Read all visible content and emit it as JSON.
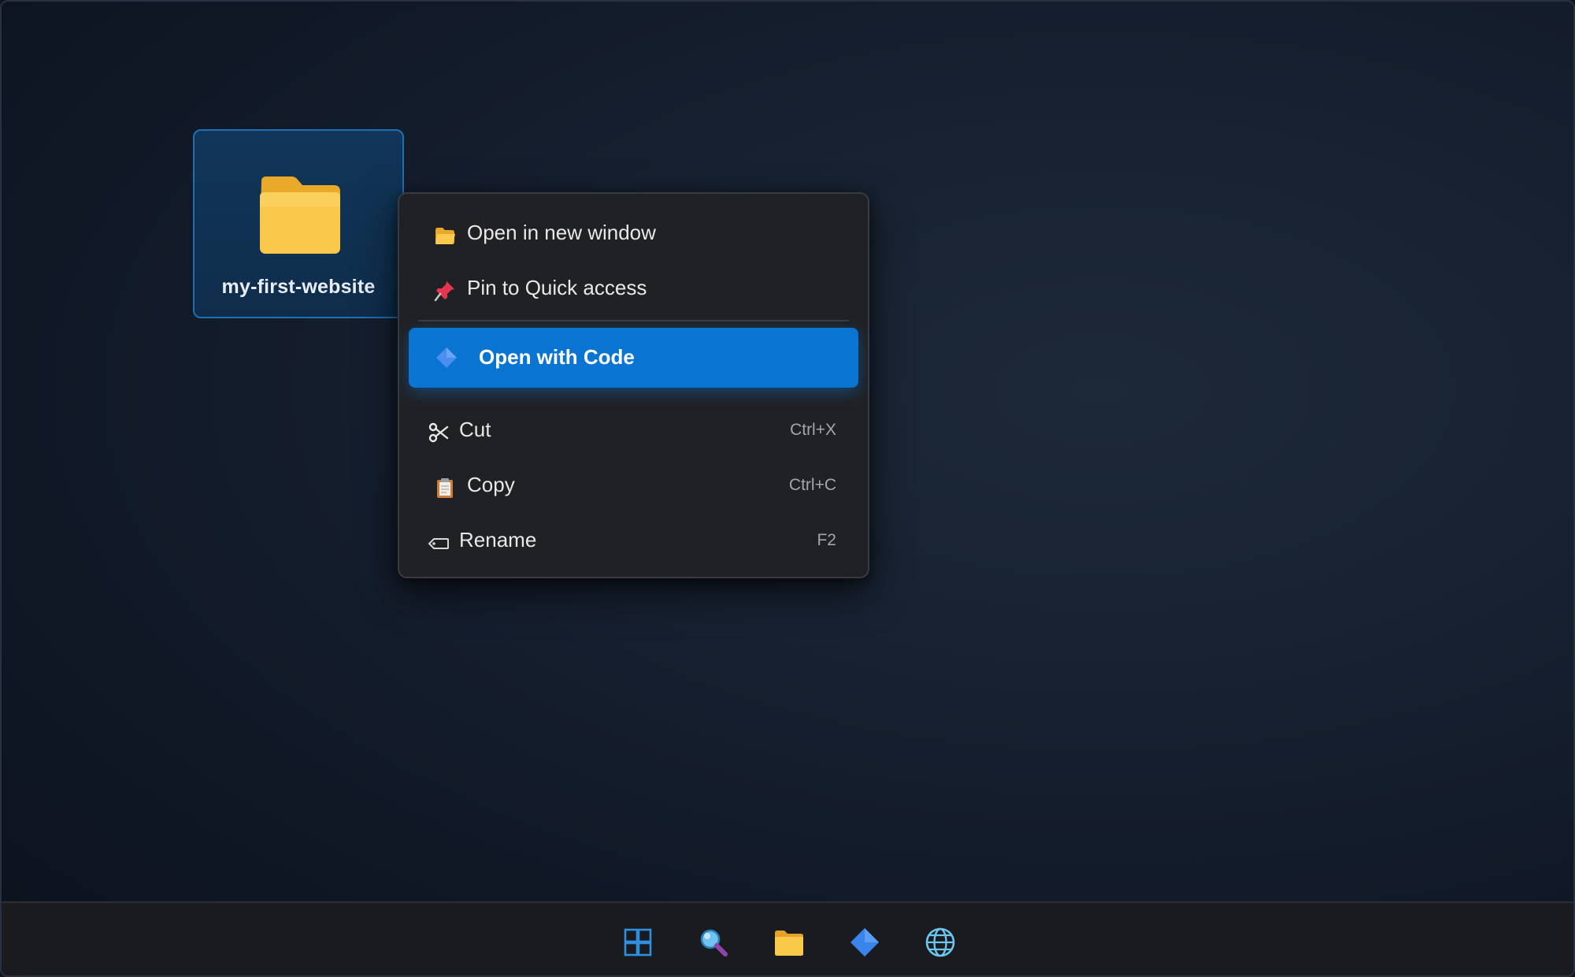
{
  "desktop": {
    "folder": {
      "name": "my-first-website",
      "icon": "folder-icon"
    }
  },
  "context_menu": {
    "items": [
      {
        "label": "Open in new window",
        "icon": "folder-open-icon",
        "shortcut": ""
      },
      {
        "label": "Pin to Quick access",
        "icon": "pushpin-icon",
        "shortcut": ""
      },
      {
        "label": "Open with Code",
        "icon": "code-diamond-icon",
        "shortcut": "",
        "highlighted": true
      },
      {
        "label": "Cut",
        "icon": "scissors-icon",
        "shortcut": "Ctrl+X"
      },
      {
        "label": "Copy",
        "icon": "clipboard-icon",
        "shortcut": "Ctrl+C"
      },
      {
        "label": "Rename",
        "icon": "rename-tag-icon",
        "shortcut": "F2"
      }
    ]
  },
  "taskbar": {
    "icons": [
      "windows-start-icon",
      "search-icon",
      "file-explorer-icon",
      "code-editor-icon",
      "browser-globe-icon"
    ]
  },
  "colors": {
    "accent": "#0a74d3",
    "menu_background": "#202124",
    "folder_yellow": "#f7c244",
    "taskbar_background": "#1a1b1e"
  }
}
